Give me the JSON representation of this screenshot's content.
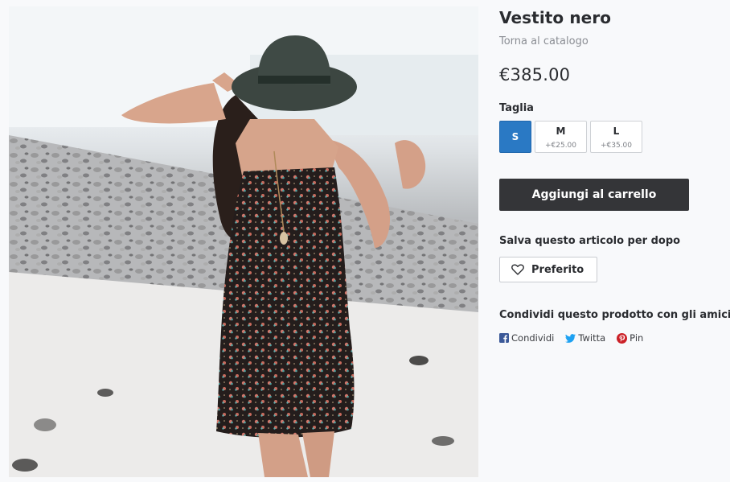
{
  "product": {
    "title": "Vestito nero",
    "back_link": "Torna al catalogo",
    "price": "€385.00",
    "image_alt": "Donna con cappello e vestito nero a fiori sulla spiaggia"
  },
  "sizes": {
    "label": "Taglia",
    "options": [
      {
        "name": "S",
        "extra": "",
        "selected": true
      },
      {
        "name": "M",
        "extra": "+€25.00",
        "selected": false
      },
      {
        "name": "L",
        "extra": "+€35.00",
        "selected": false
      }
    ]
  },
  "cart": {
    "add_label": "Aggiungi al carrello"
  },
  "save": {
    "label": "Salva questo articolo per dopo",
    "favorite_label": "Preferito"
  },
  "share": {
    "label": "Condividi questo prodotto con gli amici",
    "links": [
      {
        "icon": "facebook-icon",
        "label": "Condividi",
        "color": "#3b5998"
      },
      {
        "icon": "twitter-icon",
        "label": "Twitta",
        "color": "#1da1f2"
      },
      {
        "icon": "pinterest-icon",
        "label": "Pin",
        "color": "#cb2027"
      }
    ]
  },
  "colors": {
    "accent": "#2a79c4",
    "button_dark": "#343538"
  }
}
